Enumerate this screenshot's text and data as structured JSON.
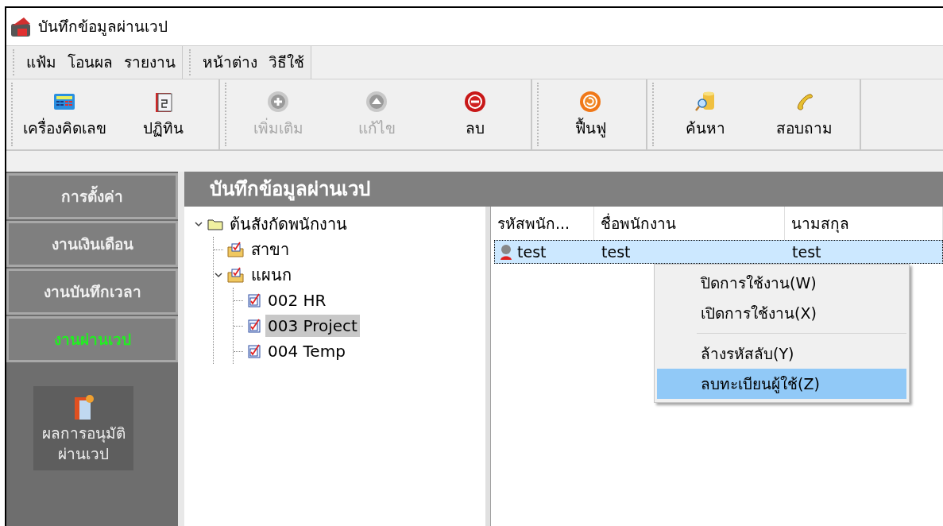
{
  "window": {
    "title": "บันทึกข้อมูลผ่านเวป"
  },
  "menu_groups": [
    [
      "แฟ้ม",
      "โอนผล",
      "รายงาน"
    ],
    [
      "หน้าต่าง",
      "วิธีใช้"
    ]
  ],
  "toolbar_groups": [
    [
      {
        "label": "เครื่องคิดเลข",
        "disabled": false
      },
      {
        "label": "ปฏิทิน",
        "disabled": false
      }
    ],
    [
      {
        "label": "เพิ่มเติม",
        "disabled": true
      },
      {
        "label": "แก้ไข",
        "disabled": true
      },
      {
        "label": "ลบ",
        "disabled": false
      }
    ],
    [
      {
        "label": "ฟื้นฟู",
        "disabled": false
      }
    ],
    [
      {
        "label": "ค้นหา",
        "disabled": false
      },
      {
        "label": "สอบถาม",
        "disabled": false
      }
    ]
  ],
  "sidebar": {
    "items": [
      {
        "label": "การตั้งค่า",
        "selected": false
      },
      {
        "label": "งานเงินเดือน",
        "selected": false
      },
      {
        "label": "งานบันทึกเวลา",
        "selected": false
      },
      {
        "label": "งานผ่านเวป",
        "selected": true
      }
    ],
    "tile": {
      "lines": [
        "ผลการอนุมัติ",
        "ผ่านเวป"
      ]
    }
  },
  "panel": {
    "title": "บันทึกข้อมูลผ่านเวป"
  },
  "tree": [
    {
      "label": "ต้นสังกัดพนักงาน",
      "kind": "folder",
      "expanded": true,
      "selected": false,
      "children": [
        {
          "label": "สาขา",
          "kind": "group",
          "selected": false
        },
        {
          "label": "แผนก",
          "kind": "group",
          "expanded": true,
          "selected": false,
          "children": [
            {
              "label": "002 HR",
              "kind": "doc",
              "selected": false
            },
            {
              "label": "003 Project",
              "kind": "doc",
              "selected": true
            },
            {
              "label": "004 Temp",
              "kind": "doc",
              "selected": false
            }
          ]
        }
      ]
    }
  ],
  "table": {
    "columns": [
      "รหัสพนัก...",
      "ชื่อพนักงาน",
      "นามสกุล"
    ],
    "rows": [
      {
        "cells": [
          "test",
          "test",
          "test"
        ],
        "selected": true
      }
    ]
  },
  "context_menu": {
    "items": [
      {
        "kind": "item",
        "label": "ปิดการใช้งาน(W)",
        "selected": false
      },
      {
        "kind": "item",
        "label": "เปิดการใช้งาน(X)",
        "selected": false
      },
      {
        "kind": "separator"
      },
      {
        "kind": "item",
        "label": "ล้างรหัสลับ(Y)",
        "selected": false
      },
      {
        "kind": "item",
        "label": "ลบทะเบียนผู้ใช้(Z)",
        "selected": true
      }
    ]
  }
}
